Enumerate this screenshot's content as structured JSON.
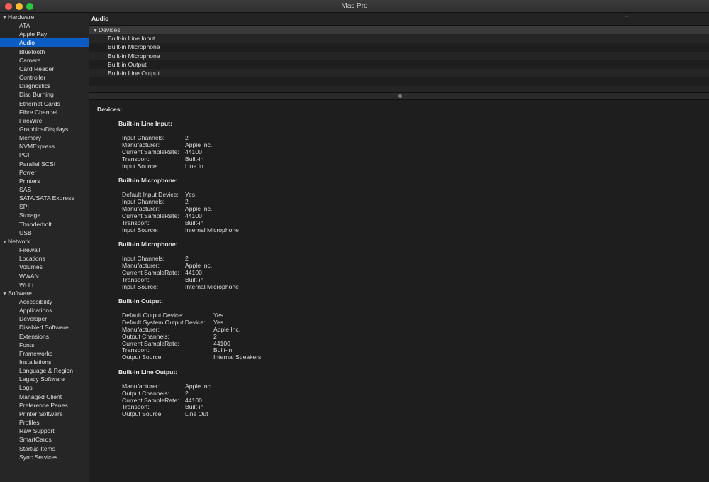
{
  "window": {
    "title": "Mac Pro"
  },
  "sidebar": {
    "groups": [
      {
        "label": "Hardware",
        "items": [
          "ATA",
          "Apple Pay",
          "Audio",
          "Bluetooth",
          "Camera",
          "Card Reader",
          "Controller",
          "Diagnostics",
          "Disc Burning",
          "Ethernet Cards",
          "Fibre Channel",
          "FireWire",
          "Graphics/Displays",
          "Memory",
          "NVMExpress",
          "PCI",
          "Parallel SCSI",
          "Power",
          "Printers",
          "SAS",
          "SATA/SATA Express",
          "SPI",
          "Storage",
          "Thunderbolt",
          "USB"
        ]
      },
      {
        "label": "Network",
        "items": [
          "Firewall",
          "Locations",
          "Volumes",
          "WWAN",
          "Wi-Fi"
        ]
      },
      {
        "label": "Software",
        "items": [
          "Accessibility",
          "Applications",
          "Developer",
          "Disabled Software",
          "Extensions",
          "Fonts",
          "Frameworks",
          "Installations",
          "Language & Region",
          "Legacy Software",
          "Logs",
          "Managed Client",
          "Preference Panes",
          "Printer Software",
          "Profiles",
          "Raw Support",
          "SmartCards",
          "Startup Items",
          "Sync Services"
        ]
      }
    ],
    "selected": "Audio"
  },
  "header": {
    "title": "Audio",
    "sort_icon": "chevron-up-icon"
  },
  "tree": {
    "group_label": "Devices",
    "items": [
      "Built-in Line Input",
      "Built-in Microphone",
      "Built-in Microphone",
      "Built-in Output",
      "Built-in Line Output"
    ]
  },
  "detail": {
    "heading": "Devices:",
    "devices": [
      {
        "name": "Built-in Line Input:",
        "props": [
          [
            "Input Channels:",
            "2"
          ],
          [
            "Manufacturer:",
            "Apple Inc."
          ],
          [
            "Current SampleRate:",
            "44100"
          ],
          [
            "Transport:",
            "Built-in"
          ],
          [
            "Input Source:",
            "Line In"
          ]
        ]
      },
      {
        "name": "Built-in Microphone:",
        "props": [
          [
            "Default Input Device:",
            "Yes"
          ],
          [
            "Input Channels:",
            "2"
          ],
          [
            "Manufacturer:",
            "Apple Inc."
          ],
          [
            "Current SampleRate:",
            "44100"
          ],
          [
            "Transport:",
            "Built-in"
          ],
          [
            "Input Source:",
            "Internal Microphone"
          ]
        ]
      },
      {
        "name": "Built-in Microphone:",
        "props": [
          [
            "Input Channels:",
            "2"
          ],
          [
            "Manufacturer:",
            "Apple Inc."
          ],
          [
            "Current SampleRate:",
            "44100"
          ],
          [
            "Transport:",
            "Built-in"
          ],
          [
            "Input Source:",
            "Internal Microphone"
          ]
        ]
      },
      {
        "name": "Built-in Output:",
        "props": [
          [
            "Default Output Device:",
            "Yes"
          ],
          [
            "Default System Output Device:",
            "Yes"
          ],
          [
            "Manufacturer:",
            "Apple Inc."
          ],
          [
            "Output Channels:",
            "2"
          ],
          [
            "Current SampleRate:",
            "44100"
          ],
          [
            "Transport:",
            "Built-in"
          ],
          [
            "Output Source:",
            "Internal Speakers"
          ]
        ]
      },
      {
        "name": "Built-in Line Output:",
        "props": [
          [
            "Manufacturer:",
            "Apple Inc."
          ],
          [
            "Output Channels:",
            "2"
          ],
          [
            "Current SampleRate:",
            "44100"
          ],
          [
            "Transport:",
            "Built-in"
          ],
          [
            "Output Source:",
            "Line Out"
          ]
        ]
      }
    ]
  }
}
